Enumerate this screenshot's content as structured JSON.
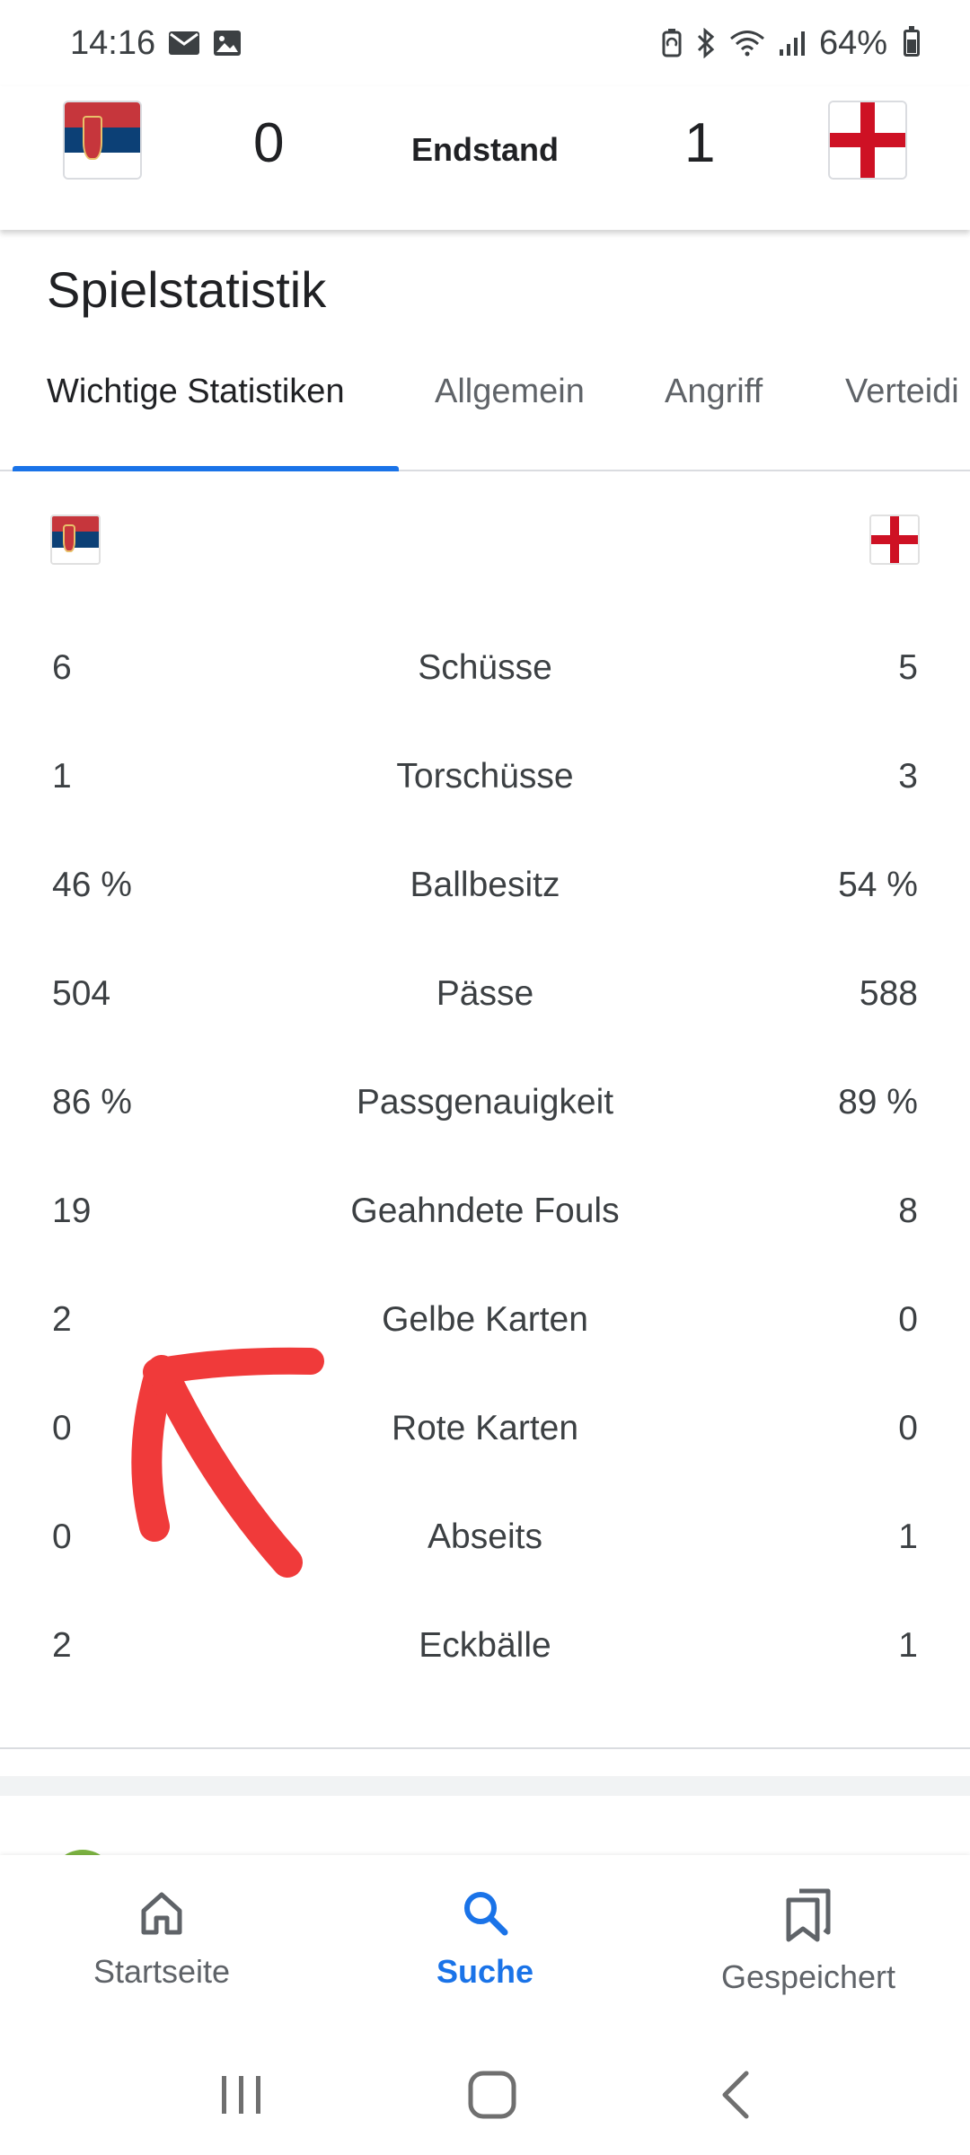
{
  "status_bar": {
    "time": "14:16",
    "battery": "64%",
    "icons": [
      "mail-icon",
      "image-icon",
      "battery-saver-icon",
      "bluetooth-icon",
      "wifi-icon",
      "signal-icon"
    ]
  },
  "match": {
    "home_team": {
      "flag": "serbia-flag",
      "score": "0"
    },
    "away_team": {
      "flag": "england-flag",
      "score": "1"
    },
    "status": "Endstand"
  },
  "section_title": "Spielstatistik",
  "tabs": [
    {
      "label": "Wichtige Statistiken",
      "active": true
    },
    {
      "label": "Allgemein",
      "active": false
    },
    {
      "label": "Angriff",
      "active": false
    },
    {
      "label": "Verteidi",
      "active": false
    }
  ],
  "stats": [
    {
      "label": "Schüsse",
      "home": "6",
      "away": "5"
    },
    {
      "label": "Torschüsse",
      "home": "1",
      "away": "3"
    },
    {
      "label": "Ballbesitz",
      "home": "46 %",
      "away": "54 %"
    },
    {
      "label": "Pässe",
      "home": "504",
      "away": "588"
    },
    {
      "label": "Passgenauigkeit",
      "home": "86 %",
      "away": "89 %"
    },
    {
      "label": "Geahndete Fouls",
      "home": "19",
      "away": "8"
    },
    {
      "label": "Gelbe Karten",
      "home": "2",
      "away": "0"
    },
    {
      "label": "Rote Karten",
      "home": "0",
      "away": "0"
    },
    {
      "label": "Abseits",
      "home": "0",
      "away": "1"
    },
    {
      "label": "Eckbälle",
      "home": "2",
      "away": "1"
    }
  ],
  "bottom_nav": [
    {
      "label": "Startseite",
      "icon": "home-icon",
      "active": false
    },
    {
      "label": "Suche",
      "icon": "search-icon",
      "active": true
    },
    {
      "label": "Gespeichert",
      "icon": "bookmarks-icon",
      "active": false
    }
  ],
  "colors": {
    "accent": "#1a73e8",
    "annotation": "#f03a3a",
    "text": "#202124",
    "secondary_text": "#5f6368"
  }
}
